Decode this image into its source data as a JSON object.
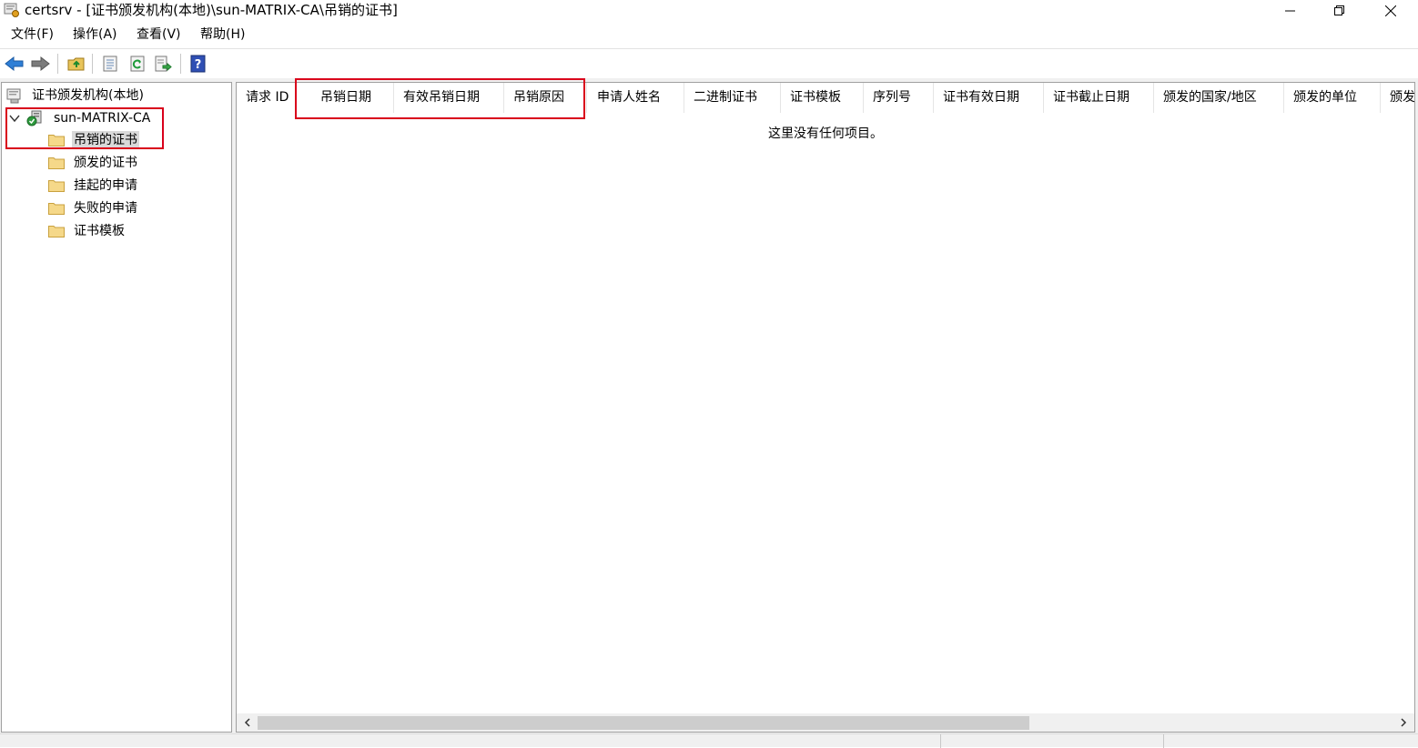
{
  "window": {
    "title": "certsrv - [证书颁发机构(本地)\\sun-MATRIX-CA\\吊销的证书]",
    "controls": {
      "minimize": "minimize-icon",
      "restore": "restore-icon",
      "close": "close-icon"
    }
  },
  "menu": [
    {
      "label": "文件(F)"
    },
    {
      "label": "操作(A)"
    },
    {
      "label": "查看(V)"
    },
    {
      "label": "帮助(H)"
    }
  ],
  "toolbar": {
    "buttons": [
      "back-arrow-icon",
      "forward-arrow-icon",
      "up-folder-icon",
      "properties-icon",
      "refresh-icon",
      "export-list-icon",
      "help-icon"
    ]
  },
  "tree": {
    "root": "证书颁发机构(本地)",
    "ca": "sun-MATRIX-CA",
    "folders": [
      "吊销的证书",
      "颁发的证书",
      "挂起的申请",
      "失败的申请",
      "证书模板"
    ],
    "selected_index": 0
  },
  "list": {
    "columns": [
      "请求 ID",
      "吊销日期",
      "有效吊销日期",
      "吊销原因",
      "申请人姓名",
      "二进制证书",
      "证书模板",
      "序列号",
      "证书有效日期",
      "证书截止日期",
      "颁发的国家/地区",
      "颁发的单位",
      "颁发"
    ],
    "empty_message": "这里没有任何项目。"
  },
  "highlight_color": "#d9001b"
}
